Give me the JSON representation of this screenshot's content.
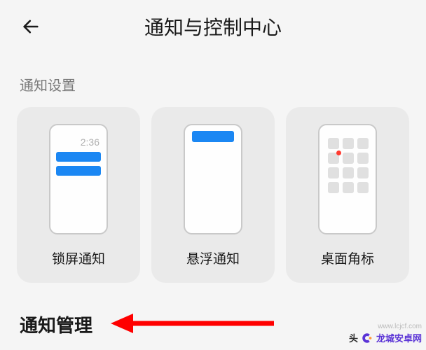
{
  "header": {
    "title": "通知与控制中心"
  },
  "section_label": "通知设置",
  "cards": {
    "lockscreen": {
      "label": "锁屏通知",
      "time": "2:36"
    },
    "floating": {
      "label": "悬浮通知"
    },
    "badge": {
      "label": "桌面角标"
    }
  },
  "bottom": {
    "title": "通知管理"
  },
  "watermark": {
    "head": "头",
    "brand": "龙城安卓网",
    "url": "www.lcjcf.com"
  },
  "colors": {
    "accent": "#1b87f3",
    "badge_dot": "#ff3b30",
    "arrow": "#ff0000",
    "brand_purple": "#5a33d6"
  }
}
